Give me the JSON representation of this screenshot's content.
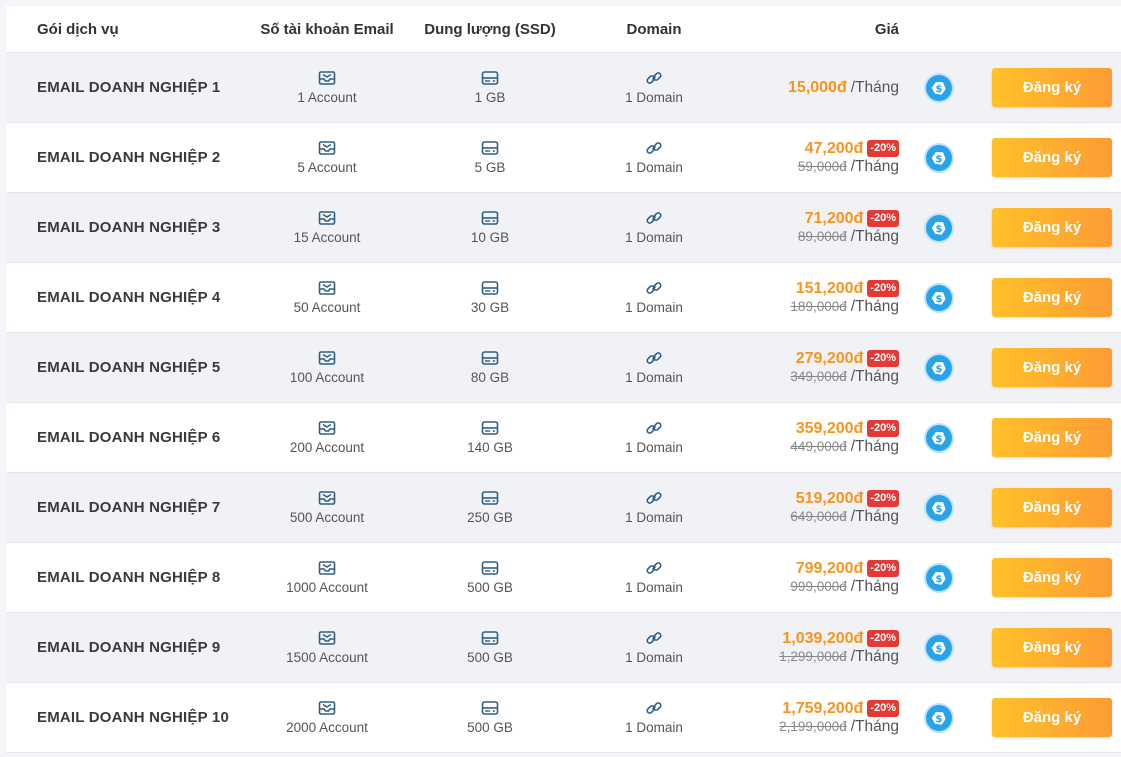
{
  "header": {
    "package": "Gói dịch vụ",
    "accounts": "Số tài khoản Email",
    "storage": "Dung lượng (SSD)",
    "domain": "Domain",
    "price": "Giá"
  },
  "colors": {
    "accent": "#f7941d",
    "discount_badge": "#e53935",
    "button_start": "#ffc12a",
    "button_end": "#fd9c33",
    "tag_icon": "#29a3e8"
  },
  "icons": {
    "accounts": "mail-inbox-icon",
    "storage": "hard-drive-icon",
    "domain": "link-icon",
    "price_tag": "price-tag-icon"
  },
  "rows": [
    {
      "name": "EMAIL DOANH NGHIỆP 1",
      "accounts": "1 Account",
      "storage": "1 GB",
      "domain": "1 Domain",
      "price": "15,000đ",
      "per": "/Tháng",
      "button": "Đăng ký"
    },
    {
      "name": "EMAIL DOANH NGHIỆP 2",
      "accounts": "5 Account",
      "storage": "5 GB",
      "domain": "1 Domain",
      "price": "47,200đ",
      "badge": "-20%",
      "old_price": "59,000đ",
      "per": "/Tháng",
      "button": "Đăng ký"
    },
    {
      "name": "EMAIL DOANH NGHIỆP 3",
      "accounts": "15 Account",
      "storage": "10 GB",
      "domain": "1 Domain",
      "price": "71,200đ",
      "badge": "-20%",
      "old_price": "89,000đ",
      "per": "/Tháng",
      "button": "Đăng ký"
    },
    {
      "name": "EMAIL DOANH NGHIỆP 4",
      "accounts": "50 Account",
      "storage": "30 GB",
      "domain": "1 Domain",
      "price": "151,200đ",
      "badge": "-20%",
      "old_price": "189,000đ",
      "per": "/Tháng",
      "button": "Đăng ký"
    },
    {
      "name": "EMAIL DOANH NGHIỆP 5",
      "accounts": "100 Account",
      "storage": "80 GB",
      "domain": "1 Domain",
      "price": "279,200đ",
      "badge": "-20%",
      "old_price": "349,000đ",
      "per": "/Tháng",
      "button": "Đăng ký"
    },
    {
      "name": "EMAIL DOANH NGHIỆP 6",
      "accounts": "200 Account",
      "storage": "140 GB",
      "domain": "1 Domain",
      "price": "359,200đ",
      "badge": "-20%",
      "old_price": "449,000đ",
      "per": "/Tháng",
      "button": "Đăng ký"
    },
    {
      "name": "EMAIL DOANH NGHIỆP 7",
      "accounts": "500 Account",
      "storage": "250 GB",
      "domain": "1 Domain",
      "price": "519,200đ",
      "badge": "-20%",
      "old_price": "649,000đ",
      "per": "/Tháng",
      "button": "Đăng ký"
    },
    {
      "name": "EMAIL DOANH NGHIỆP 8",
      "accounts": "1000 Account",
      "storage": "500 GB",
      "domain": "1 Domain",
      "price": "799,200đ",
      "badge": "-20%",
      "old_price": "999,000đ",
      "per": "/Tháng",
      "button": "Đăng ký"
    },
    {
      "name": "EMAIL DOANH NGHIỆP 9",
      "accounts": "1500 Account",
      "storage": "500 GB",
      "domain": "1 Domain",
      "price": "1,039,200đ",
      "badge": "-20%",
      "old_price": "1,299,000đ",
      "per": "/Tháng",
      "button": "Đăng ký"
    },
    {
      "name": "EMAIL DOANH NGHIỆP 10",
      "accounts": "2000 Account",
      "storage": "500 GB",
      "domain": "1 Domain",
      "price": "1,759,200đ",
      "badge": "-20%",
      "old_price": "2,199,000đ",
      "per": "/Tháng",
      "button": "Đăng ký"
    }
  ]
}
